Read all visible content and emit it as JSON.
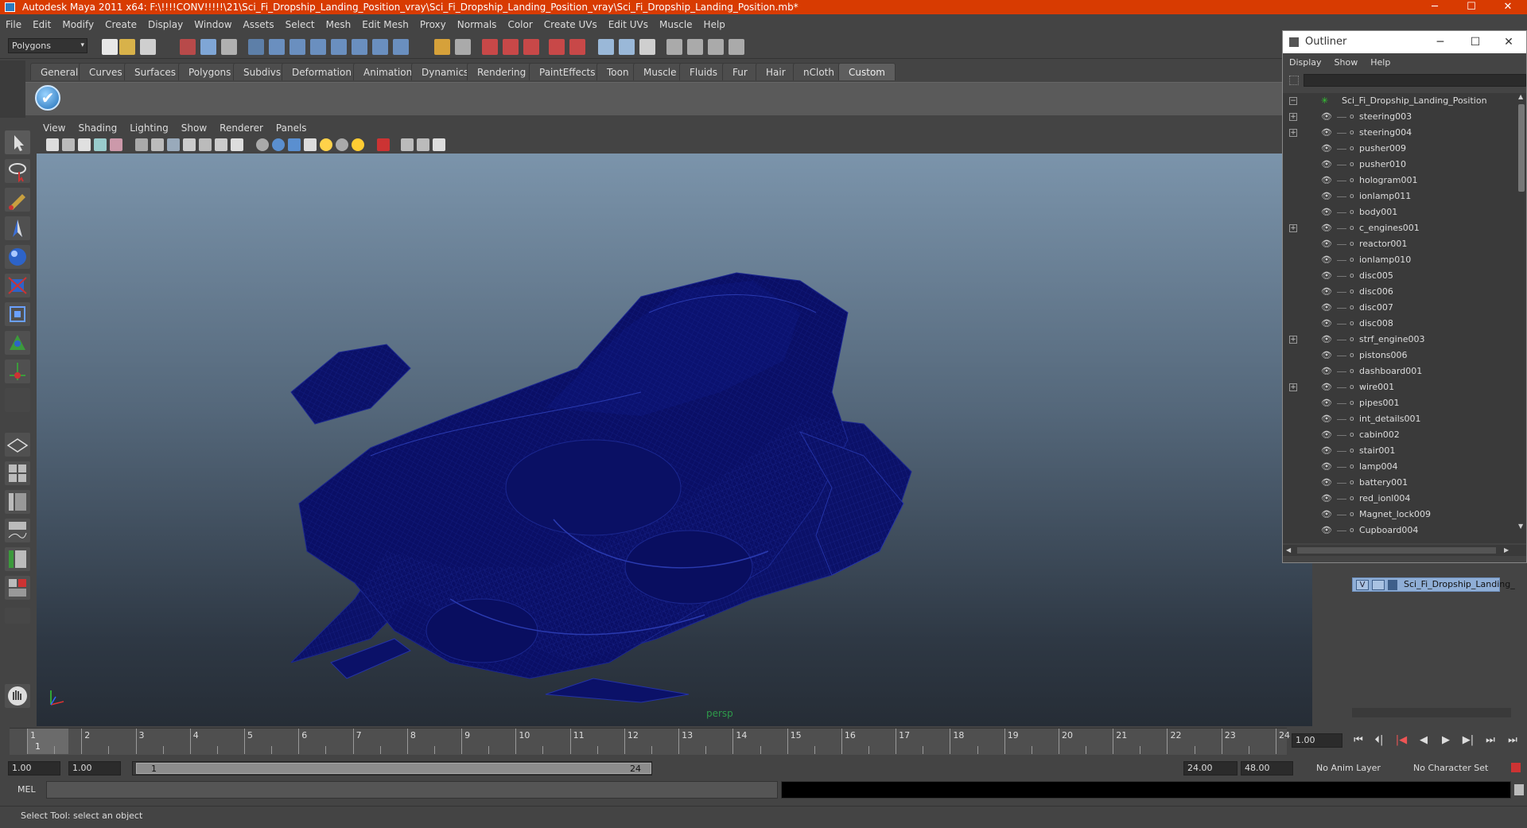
{
  "window": {
    "title": "Autodesk Maya 2011 x64: F:\\!!!!CONV!!!!!\\21\\Sci_Fi_Dropship_Landing_Position_vray\\Sci_Fi_Dropship_Landing_Position_vray\\Sci_Fi_Dropship_Landing_Position.mb*",
    "minimize": "─",
    "maximize": "☐",
    "close": "✕"
  },
  "menubar": [
    "File",
    "Edit",
    "Modify",
    "Create",
    "Display",
    "Window",
    "Assets",
    "Select",
    "Mesh",
    "Edit Mesh",
    "Proxy",
    "Normals",
    "Color",
    "Create UVs",
    "Edit UVs",
    "Muscle",
    "Help"
  ],
  "status_line": {
    "menu_set": "Polygons",
    "menu_set_arrow": "▾"
  },
  "shelf": {
    "tabs": [
      "General",
      "Curves",
      "Surfaces",
      "Polygons",
      "Subdivs",
      "Deformation",
      "Animation",
      "Dynamics",
      "Rendering",
      "PaintEffects",
      "Toon",
      "Muscle",
      "Fluids",
      "Fur",
      "Hair",
      "nCloth",
      "Custom"
    ],
    "active_tab": "Custom",
    "check_glyph": "✔"
  },
  "viewport": {
    "menu": [
      "View",
      "Shading",
      "Lighting",
      "Show",
      "Renderer",
      "Panels"
    ],
    "camera_label": "persp",
    "wire_color": "#0e1673",
    "fill_color": "#0a0f66"
  },
  "outliner": {
    "title": "Outliner",
    "menu": [
      "Display",
      "Show",
      "Help"
    ],
    "minimize": "─",
    "maximize": "☐",
    "close": "✕",
    "expand_glyph": "+",
    "collapse_glyph": "−",
    "visible_glyph": "👁",
    "root": "Sci_Fi_Dropship_Landing_Position",
    "items": [
      {
        "name": "steering003",
        "expandable": true
      },
      {
        "name": "steering004",
        "expandable": true
      },
      {
        "name": "pusher009",
        "expandable": false
      },
      {
        "name": "pusher010",
        "expandable": false
      },
      {
        "name": "hologram001",
        "expandable": false
      },
      {
        "name": "ionlamp011",
        "expandable": false
      },
      {
        "name": "body001",
        "expandable": false
      },
      {
        "name": "c_engines001",
        "expandable": true
      },
      {
        "name": "reactor001",
        "expandable": false
      },
      {
        "name": "ionlamp010",
        "expandable": false
      },
      {
        "name": "disc005",
        "expandable": false
      },
      {
        "name": "disc006",
        "expandable": false
      },
      {
        "name": "disc007",
        "expandable": false
      },
      {
        "name": "disc008",
        "expandable": false
      },
      {
        "name": "strf_engine003",
        "expandable": true
      },
      {
        "name": "pistons006",
        "expandable": false
      },
      {
        "name": "dashboard001",
        "expandable": false
      },
      {
        "name": "wire001",
        "expandable": true
      },
      {
        "name": "pipes001",
        "expandable": false
      },
      {
        "name": "int_details001",
        "expandable": false
      },
      {
        "name": "cabin002",
        "expandable": false
      },
      {
        "name": "stair001",
        "expandable": false
      },
      {
        "name": "lamp004",
        "expandable": false
      },
      {
        "name": "battery001",
        "expandable": false
      },
      {
        "name": "red_ionl004",
        "expandable": false
      },
      {
        "name": "Magnet_lock009",
        "expandable": false
      },
      {
        "name": "Cupboard004",
        "expandable": false
      }
    ]
  },
  "layers": {
    "visible_flag": "V",
    "layer_name": "Sci_Fi_Dropship_Landing_"
  },
  "timeline": {
    "ticks": [
      "1",
      "2",
      "3",
      "4",
      "5",
      "6",
      "7",
      "8",
      "9",
      "10",
      "11",
      "12",
      "13",
      "14",
      "15",
      "16",
      "17",
      "18",
      "19",
      "20",
      "21",
      "22",
      "23",
      "24"
    ],
    "current_frame_marker": "1",
    "current_frame": "1.00",
    "playback": [
      "⏮",
      "⏴|",
      "|◀",
      "◀",
      "▶",
      "▶|",
      "⏭",
      "⏭"
    ]
  },
  "range": {
    "start_time": "1.00",
    "playback_start": "1.00",
    "slider_start": "1",
    "slider_end": "24",
    "playback_end": "24.00",
    "end_time": "48.00",
    "anim_layer": "No Anim Layer",
    "character_set": "No Character Set"
  },
  "command_line": {
    "label": "MEL"
  },
  "help_line": "Select Tool: select an object"
}
